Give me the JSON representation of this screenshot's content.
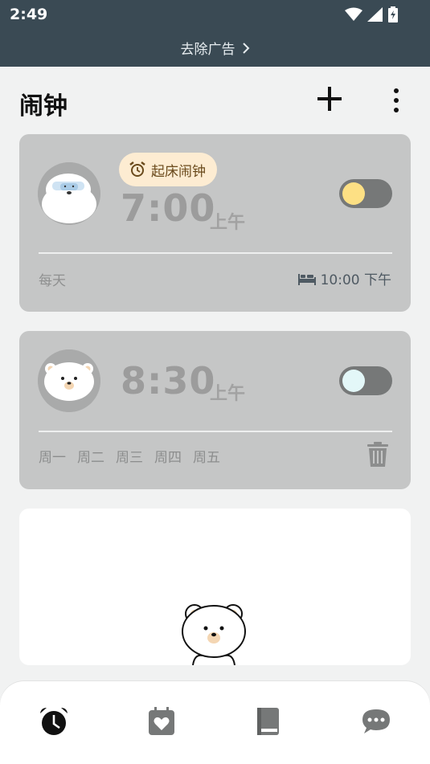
{
  "status_bar": {
    "time": "2:49"
  },
  "ad_bar": {
    "text": "去除广告"
  },
  "header": {
    "title": "闹钟"
  },
  "alarms": [
    {
      "label": "起床闹钟",
      "time": "7:00",
      "period": "上午",
      "enabled": true,
      "repeat": "每天",
      "sleep_time": "10:00 下午",
      "knob_color": "#fde084"
    },
    {
      "time": "8:30",
      "period": "上午",
      "enabled": false,
      "days": [
        "周一",
        "周二",
        "周三",
        "周四",
        "周五"
      ],
      "knob_color": "#e3f7f8"
    }
  ],
  "bottom_nav": {
    "items": [
      {
        "icon": "alarm-clock-icon",
        "active": true
      },
      {
        "icon": "calendar-heart-icon",
        "active": false
      },
      {
        "icon": "book-icon",
        "active": false
      },
      {
        "icon": "chat-bubble-icon",
        "active": false
      }
    ]
  },
  "colors": {
    "status_bg": "#3a4a54",
    "card_bg": "#c5c6c6",
    "page_bg": "#f1f2f2"
  }
}
